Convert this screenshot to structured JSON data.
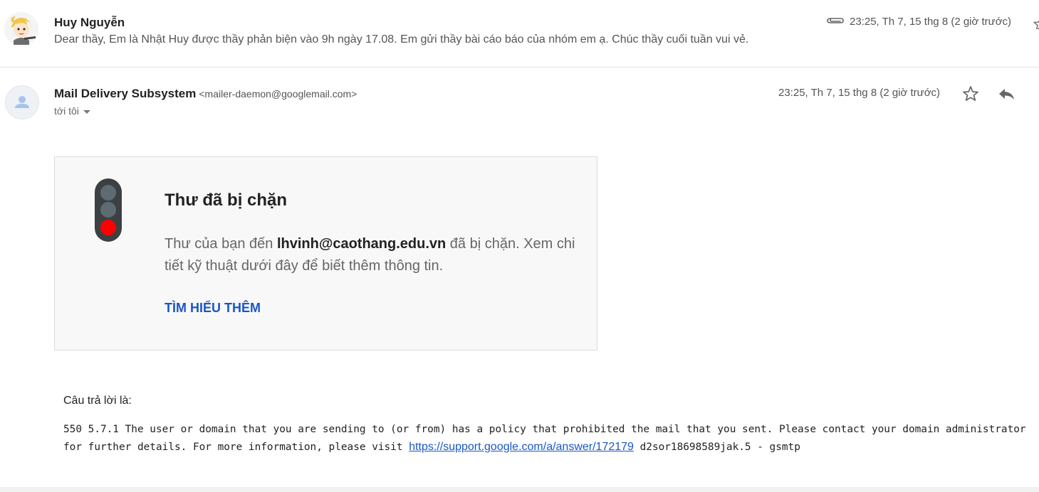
{
  "messages": {
    "collapsed": {
      "sender": "Huy Nguyễn",
      "snippet": "Dear thầy, Em là Nhật Huy được thầy phản biện vào 9h ngày 17.08. Em gửi thầy bài cáo báo của nhóm em ạ. Chúc thầy cuối tuần vui vẻ.",
      "date": "23:25, Th 7, 15 thg 8 (2 giờ trước)",
      "has_attachment": true
    },
    "expanded": {
      "sender": "Mail Delivery Subsystem",
      "email": "<mailer-daemon@googlemail.com>",
      "to_label": "tới tôi",
      "date": "23:25, Th 7, 15 thg 8 (2 giờ trước)"
    }
  },
  "blocked_card": {
    "title": "Thư đã bị chặn",
    "body_prefix": "Thư của bạn đến ",
    "recipient": "lhvinh@caothang.edu.vn",
    "body_suffix": " đã bị chặn. Xem chi tiết kỹ thuật dưới đây để biết thêm thông tin.",
    "learn_more": "TÌM HIỂU THÊM"
  },
  "details": {
    "reply_label": "Câu trả lời là:",
    "line1": "550 5.7.1 The user or domain that you are sending to (or from) has a policy that prohibited the mail that you sent. Please contact your domain administrator",
    "line2_prefix": "for further details. For more information, please visit ",
    "link": "https://support.google.com/a/answer/172179",
    "line2_suffix": " d2sor18698589jak.5 - gsmtp"
  },
  "colors": {
    "link": "#1a57c5",
    "traffic_body": "#3c4043",
    "light_off": "#5f6b73",
    "light_on": "#ff0000"
  },
  "icons": [
    "avatar",
    "paperclip-icon",
    "star-icon",
    "reply-icon",
    "traffic-light-icon",
    "person-icon",
    "caret-down-icon"
  ]
}
